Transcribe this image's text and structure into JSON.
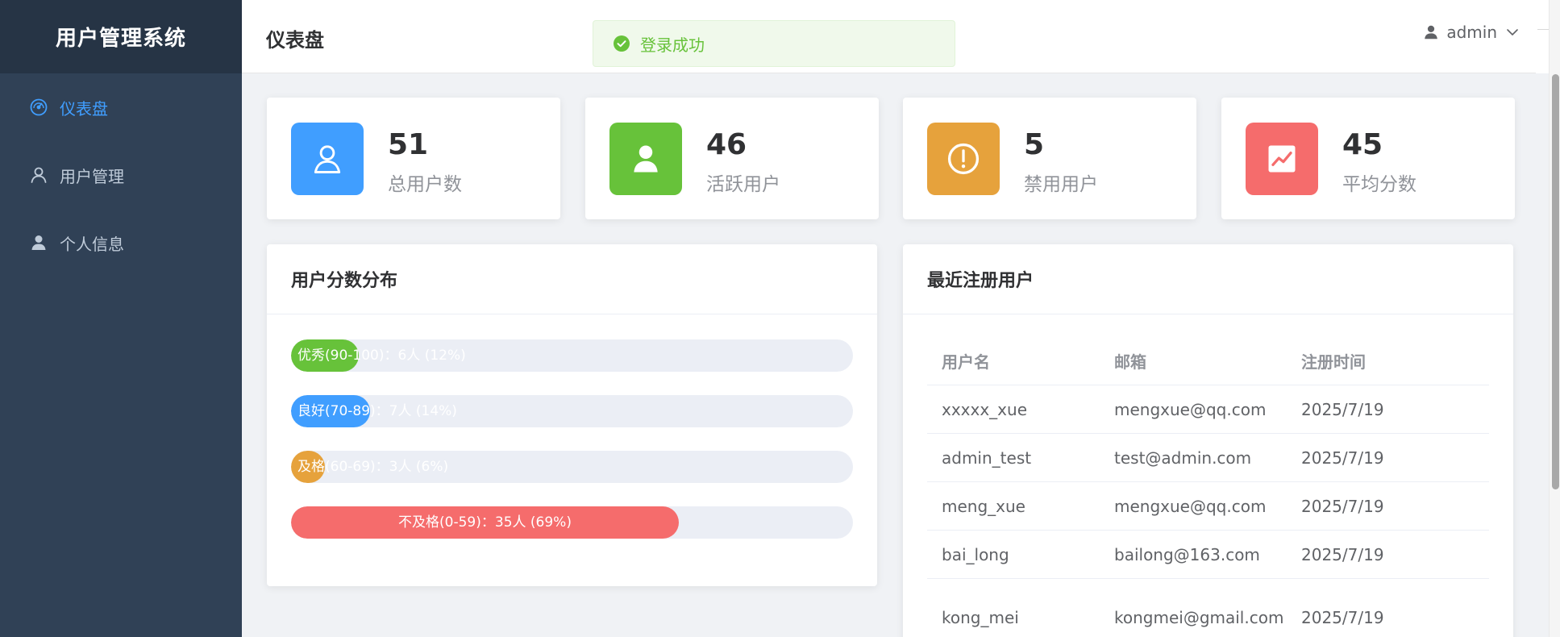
{
  "app": {
    "title": "用户管理系统"
  },
  "sidebar": {
    "items": [
      {
        "label": "仪表盘",
        "icon": "dashboard-icon",
        "active": true
      },
      {
        "label": "用户管理",
        "icon": "user-icon",
        "active": false
      },
      {
        "label": "个人信息",
        "icon": "user-filled-icon",
        "active": false
      }
    ]
  },
  "header": {
    "page_title": "仪表盘",
    "user_name": "admin"
  },
  "toast": {
    "message": "登录成功",
    "color": "#67c23a"
  },
  "stats": [
    {
      "value": "51",
      "label": "总用户数",
      "color": "#409eff",
      "icon": "user-icon"
    },
    {
      "value": "46",
      "label": "活跃用户",
      "color": "#67c23a",
      "icon": "user-filled-icon"
    },
    {
      "value": "5",
      "label": "禁用用户",
      "color": "#e6a23c",
      "icon": "warning-icon"
    },
    {
      "value": "45",
      "label": "平均分数",
      "color": "#f56c6c",
      "icon": "trend-chart-icon"
    }
  ],
  "score_panel": {
    "title": "用户分数分布",
    "bars": [
      {
        "label": "优秀(90-100)：6人 (12%)",
        "percent": 12,
        "color": "#67c23a"
      },
      {
        "label": "良好(70-89)：7人 (14%)",
        "percent": 14,
        "color": "#409eff"
      },
      {
        "label": "及格(60-69)：3人 (6%)",
        "percent": 6,
        "color": "#e6a23c"
      },
      {
        "label": "不及格(0-59)：35人 (69%)",
        "percent": 69,
        "color": "#f56c6c"
      }
    ]
  },
  "recent_panel": {
    "title": "最近注册用户",
    "columns": [
      "用户名",
      "邮箱",
      "注册时间"
    ],
    "rows": [
      [
        "xxxxx_xue",
        "mengxue@qq.com",
        "2025/7/19"
      ],
      [
        "admin_test",
        "test@admin.com",
        "2025/7/19"
      ],
      [
        "meng_xue",
        "mengxue@qq.com",
        "2025/7/19"
      ],
      [
        "bai_long",
        "bailong@163.com",
        "2025/7/19"
      ],
      [
        "kong_mei",
        "kongmei@gmail.com",
        "2025/7/19"
      ]
    ]
  }
}
